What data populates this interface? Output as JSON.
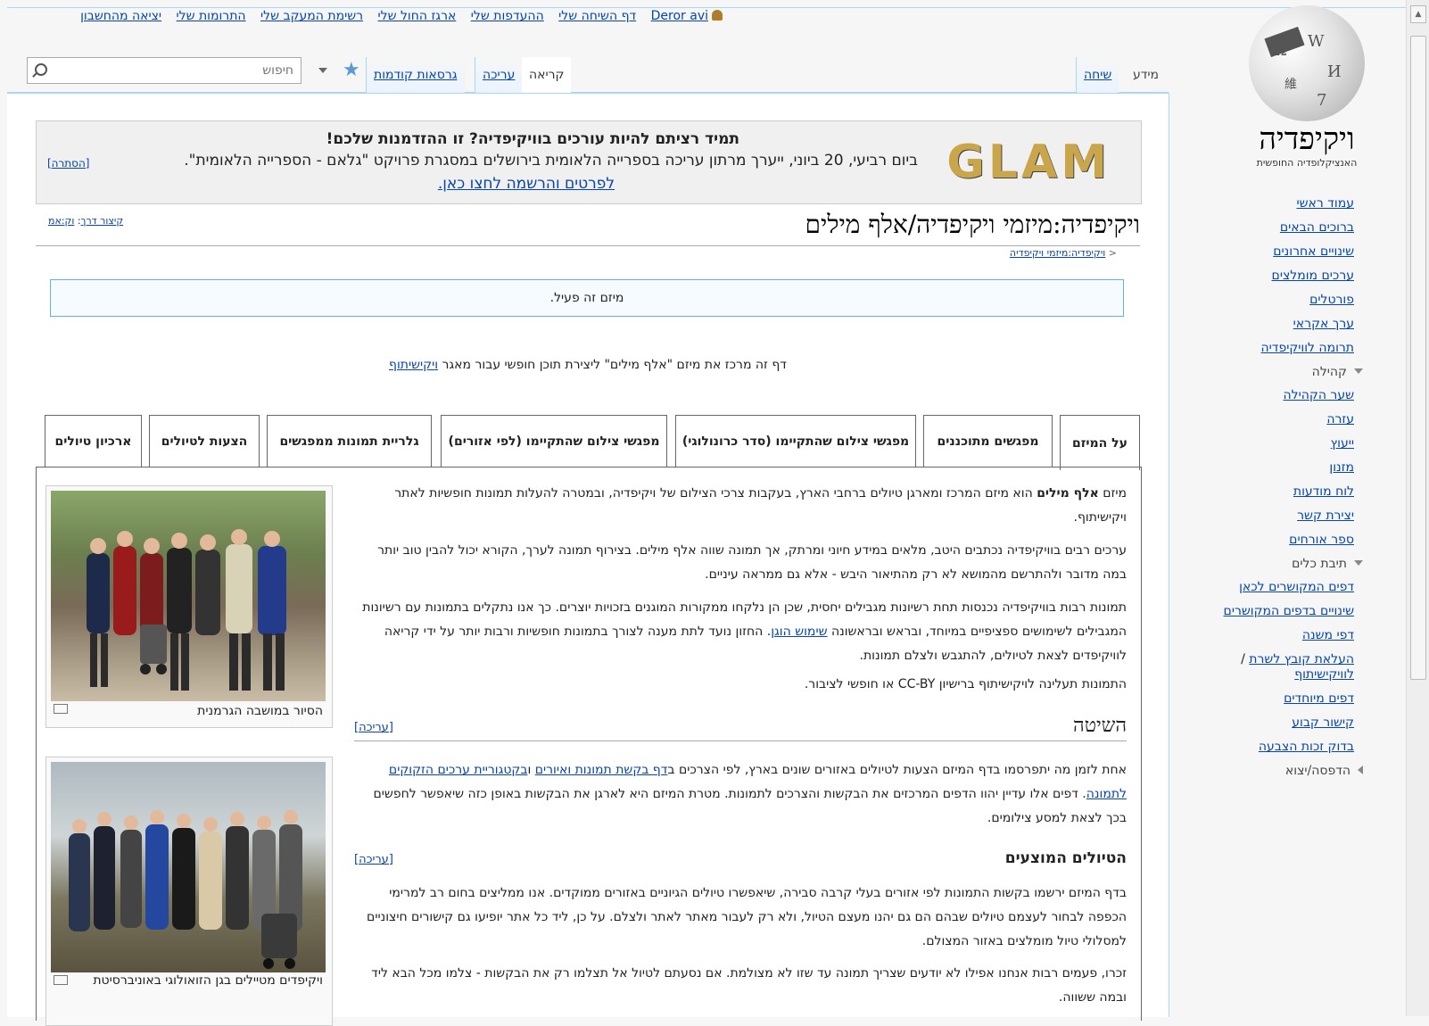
{
  "personal": {
    "user": "Deror avi",
    "items": [
      "דף השיחה שלי",
      "ההעדפות שלי",
      "ארגז החול שלי",
      "רשימת המעקב שלי",
      "התרומות שלי",
      "יציאה מהחשבון"
    ]
  },
  "logo": {
    "title": "ויקיפדיה",
    "tagline": "האנציקלופדיה החופשית"
  },
  "namespace_tabs": {
    "info": "מידע",
    "talk": "שיחה"
  },
  "view_tabs": {
    "read": "קריאה",
    "edit": "עריכה",
    "history": "גרסאות קודמות"
  },
  "search": {
    "placeholder": "חיפוש"
  },
  "banner": {
    "logo_text": "GLAM",
    "title": "תמיד רציתם להיות עורכים בוויקיפדיה? זו ההזדמנות שלכם!",
    "body": "ביום רביעי, 20 ביוני, ייערך מרתון עריכה בספרייה הלאומית בירושלים במסגרת פרויקט \"גלאם - הספרייה הלאומית\".",
    "link": "לפרטים והרשמה לחצו כאן.",
    "hide": "[הסתרה]"
  },
  "page": {
    "title": "ויקיפדיה:מיזמי ויקיפדיה/אלף מילים",
    "shortcut_label": "קיצור דרך",
    "shortcut_value": "וק:אמ",
    "breadcrumb": "ויקיפדיה:מיזמי ויקיפדיה",
    "breadcrumb_sep": "<",
    "status": "מיזם זה פעיל.",
    "intro_text": "דף זה מרכז את מיזם \"אלף מילים\" ליצירת תוכן חופשי עבור מאגר ",
    "intro_link": "ויקישיתוף"
  },
  "subtabs": [
    "על המיזם",
    "מפגשים מתוכננים",
    "מפגשי צילום שהתקיימו (סדר כרונולוגי)",
    "מפגשי צילום שהתקיימו (לפי אזורים)",
    "גלריית תמונות ממפגשים",
    "הצעות לטיולים",
    "ארכיון טיולים"
  ],
  "thumbs": [
    {
      "caption": "הסיור במושבה הגרמנית"
    },
    {
      "caption": "ויקיפדים מטיילים בגן הזואולוגי באוניברסיטת"
    }
  ],
  "body": {
    "p1_a": "מיזם ",
    "p1_b": "אלף מילים",
    "p1_c": " הוא מיזם המרכז ומארגן טיולים ברחבי הארץ, בעקבות צרכי הצילום של ויקיפדיה, ובמטרה להעלות תמונות חופשיות לאתר ויקישיתוף.",
    "p2": "ערכים רבים בוויקיפדיה נכתבים היטב, מלאים במידע חיוני ומרתק, אך תמונה שווה אלף מילים. בצירוף תמונה לערך, הקורא יכול להבין טוב יותר במה מדובר ולהתרשם מהמושא לא רק מהתיאור היבש - אלא גם ממראה עיניים.",
    "p3_a": "תמונות רבות בוויקיפדיה נכנסות תחת רשיונות מגבילים יחסית, שכן הן נלקחו ממקורות המוגנים בזכויות יוצרים. כך אנו נתקלים בתמונות עם רשיונות המגבילים לשימושים ספציפיים במיוחד, ובראש ובראשונה ",
    "p3_link": "שימוש הוגן",
    "p3_b": ". החזון נועד לתת מענה לצורך בתמונות חופשיות ורבות יותר על ידי קריאה לוויקיפדים לצאת לטיולים, להתגבש ולצלם תמונות.",
    "p4": "התמונות תעלינה לויקישיתוף ברישיון CC-BY או חופשי לציבור.",
    "h_method": "השיטה",
    "edit_label": "[עריכה]",
    "p5_a": "אחת לזמן מה יתפרסמו בדף המיזם הצעות לטיולים באזורים שונים בארץ, לפי הצרכים ב",
    "p5_link1": "דף בקשת תמונות ואיורים",
    "p5_b": " ו",
    "p5_link2": "בקטגוריית ערכים הזקוקים לתמונה",
    "p5_c": ". דפים אלו עדיין יהוו הדפים המרכזים את הבקשות והצרכים לתמונות. מטרת המיזם היא לארגן את הבקשות באופן כזה שיאפשר לחפשים בכך לצאת למסע צילומים.",
    "h_trips": "הטיולים המוצעים",
    "p6": "בדף המיזם ירשמו בקשות התמונות לפי אזורים בעלי קרבה סבירה, שיאפשרו טיולים הגיוניים באזורים ממוקדים. אנו ממליצים בחום רב למרימי הכפפה לבחור לעצמם טיולים שבהם הם גם יהנו מעצם הטיול, ולא רק לעבור מאתר לאתר ולצלם. על כן, ליד כל אתר יופיעו גם קישורים חיצוניים למסלולי טיול מומלצים באזור המצולם.",
    "p7": "זכרו, פעמים רבות אנחנו אפילו לא יודעים שצריך תמונה עד שזו לא מצולמת. אם נסעתם לטיול אל תצלמו רק את הבקשות - צלמו מכל הבא ליד ובמה ששווה."
  },
  "sidebar": {
    "nav": [
      "עמוד ראשי",
      "ברוכים הבאים",
      "שינויים אחרונים",
      "ערכים מומלצים",
      "פורטלים",
      "ערך אקראי",
      "תרומה לוויקיפדיה"
    ],
    "community_heading": "קהילה",
    "community": [
      "שער הקהילה",
      "עזרה",
      "ייעוץ",
      "מזנון",
      "לוח מודעות",
      "יצירת קשר",
      "ספר אורחים"
    ],
    "toolbox_heading": "תיבת כלים",
    "toolbox": [
      "דפים המקושרים לכאן",
      "שינויים בדפים המקושרים",
      "דפי משנה"
    ],
    "upload_a": "העלאת קובץ לשרת",
    "upload_b": "לוויקישיתוף",
    "upload_sep": " / ",
    "toolbox2": [
      "דפים מיוחדים",
      "קישור קבוע",
      "בדוק זכות הצבעה"
    ],
    "print_heading": "הדפסה/יצוא"
  }
}
